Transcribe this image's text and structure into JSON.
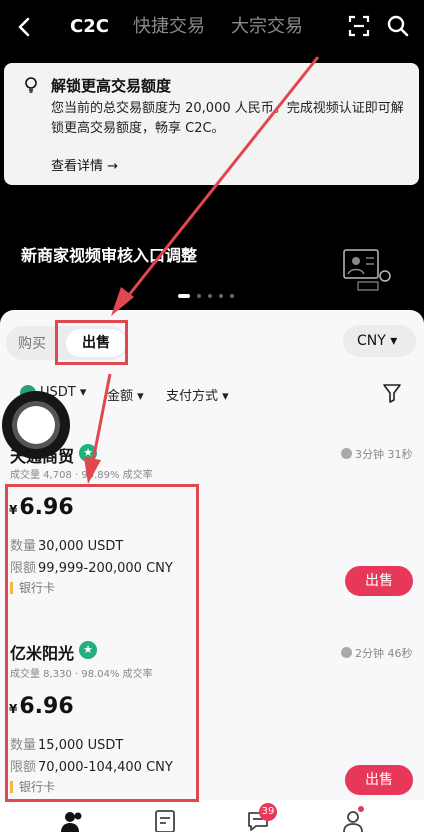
{
  "topbar": {
    "tabs": [
      "C2C",
      "快捷交易",
      "大宗交易"
    ],
    "back_icon": "back-arrow-icon",
    "scan_icon": "scan-icon",
    "search_icon": "search-icon"
  },
  "notice": {
    "title": "解锁更高交易额度",
    "description": "您当前的总交易额度为 20,000 人民币。完成视频认证即可解锁更高交易额度，畅享 C2C。",
    "link": "查看详情 →"
  },
  "banner": {
    "text": "新商家视频审核入口调整",
    "active_dot": 0
  },
  "trade_side": {
    "buy": "购买",
    "sell": "出售"
  },
  "currency": "CNY ▾",
  "filters": {
    "coin": "USDT ▾",
    "amount": "金额 ▾",
    "payment": "支付方式 ▾"
  },
  "offers": [
    {
      "merchant": "天通商贸",
      "stats": "成交量 4,708 · 99.89% 成交率",
      "time": "3分钟 31秒",
      "price": "6.96",
      "quantity_label": "数量",
      "quantity": "30,000 USDT",
      "limit_label": "限额",
      "limit": "99,999-200,000 CNY",
      "payment": "银行卡",
      "action": "出售"
    },
    {
      "merchant": "亿米阳光",
      "stats": "成交量 8,330 · 98.04% 成交率",
      "time": "2分钟 46秒",
      "price": "6.96",
      "quantity_label": "数量",
      "quantity": "15,000 USDT",
      "limit_label": "限额",
      "limit": "70,000-104,400 CNY",
      "payment": "银行卡",
      "action": "出售"
    }
  ],
  "currency_symbol": "¥",
  "bottomnav": {
    "messages_badge": "39"
  },
  "colors": {
    "accent": "#e8385a",
    "annotation": "#e0474f",
    "verified": "#21b07e"
  }
}
